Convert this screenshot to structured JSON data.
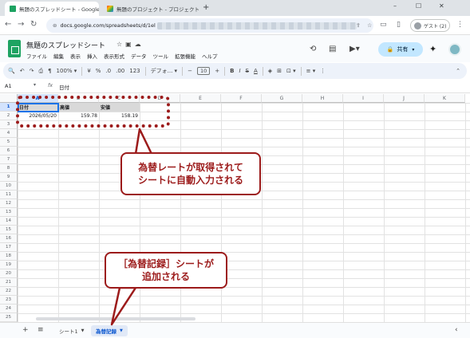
{
  "browser": {
    "tabs": [
      {
        "title": "無題のスプレッドシート - Google ス",
        "active": true
      },
      {
        "title": "無題のプロジェクト - プロジェクト編集",
        "active": false
      }
    ],
    "new_tab": "+",
    "url_prefix": "docs.google.com/spreadsheets/d/1el",
    "guest_label": "ゲスト (2)",
    "window_min": "–",
    "window_max": "☐",
    "window_close": "✕"
  },
  "sheets": {
    "doc_title": "無題のスプレッドシート",
    "menu": [
      "ファイル",
      "編集",
      "表示",
      "挿入",
      "表示形式",
      "データ",
      "ツール",
      "拡張機能",
      "ヘルプ"
    ],
    "share_label": "共有",
    "toolbar": {
      "zoom": "100%",
      "currency": "¥",
      "percent": "%",
      "decimal_dec": ".0",
      "decimal_inc": ".00",
      "number_format": "123",
      "font": "デフォ...",
      "font_size": "10",
      "minus": "−",
      "plus": "+",
      "bold": "B",
      "italic": "I",
      "strike": "S",
      "text_color": "A"
    },
    "name_box": "A1",
    "formula": "日付",
    "columns": [
      "A",
      "B",
      "C",
      "D",
      "E",
      "F",
      "G",
      "H",
      "I",
      "J",
      "K"
    ],
    "rows": [
      "1",
      "2",
      "3",
      "4",
      "5",
      "6",
      "7",
      "8",
      "9",
      "10",
      "11",
      "12",
      "13",
      "14",
      "15",
      "16",
      "17",
      "18",
      "19",
      "20",
      "21",
      "22",
      "23",
      "24",
      "25"
    ],
    "data": {
      "headers": [
        "日付",
        "高値",
        "安値"
      ],
      "row2": [
        "2026/05/20",
        "159.78",
        "158.19"
      ]
    },
    "sheet_tabs": [
      {
        "label": "シート1",
        "active": false
      },
      {
        "label": "為替記録",
        "active": true
      }
    ]
  },
  "annotations": {
    "callout1_line1": "為替レートが取得されて",
    "callout1_line2": "シートに自動入力される",
    "callout2_line1": "［為替記録］シートが",
    "callout2_line2": "追加される",
    "color": "#9c1b1b"
  }
}
